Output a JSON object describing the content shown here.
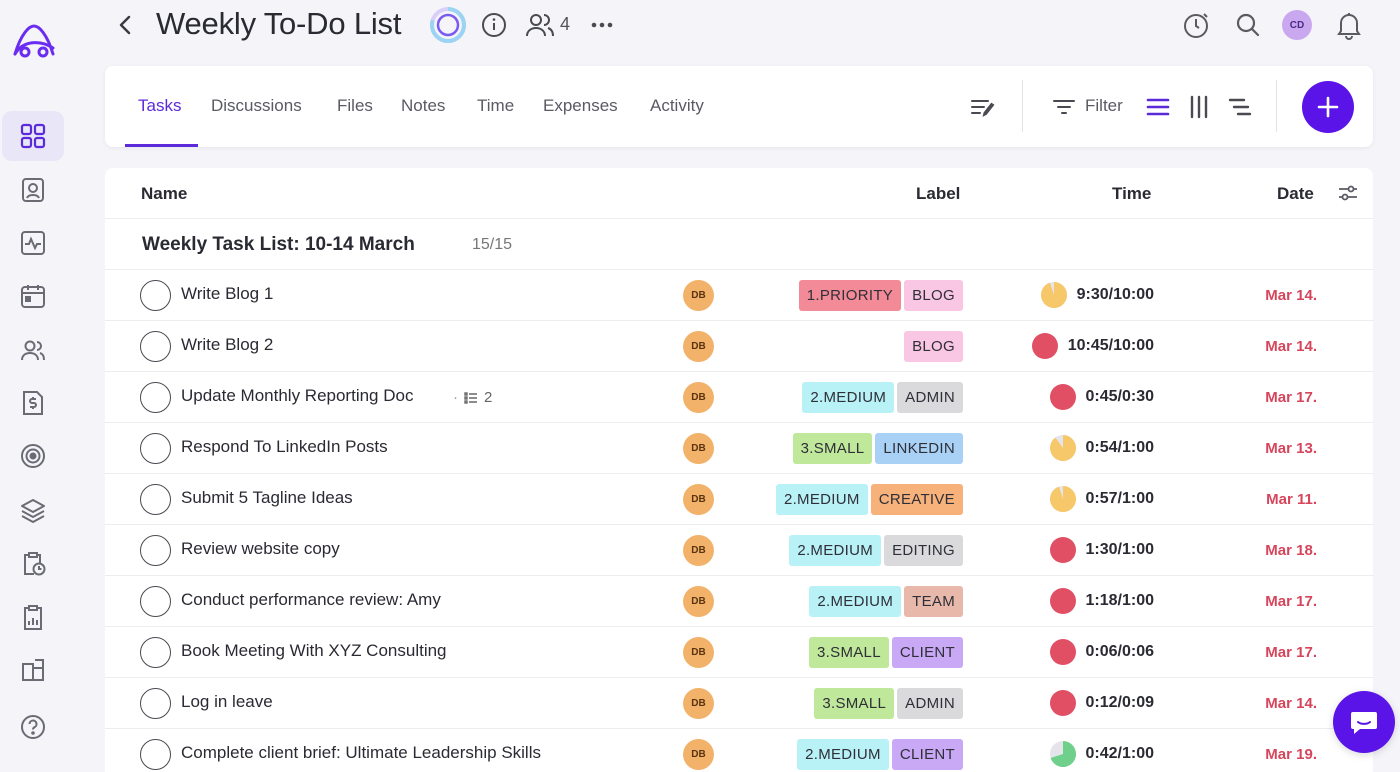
{
  "header": {
    "title": "Weekly To-Do List",
    "member_count": "4",
    "avatar_initials": "CD"
  },
  "tabs": [
    {
      "label": "Tasks",
      "active": true
    },
    {
      "label": "Discussions",
      "active": false
    },
    {
      "label": "Files",
      "active": false
    },
    {
      "label": "Notes",
      "active": false
    },
    {
      "label": "Time",
      "active": false
    },
    {
      "label": "Expenses",
      "active": false
    },
    {
      "label": "Activity",
      "active": false
    }
  ],
  "toolbar": {
    "filter_label": "Filter",
    "active_view": "list"
  },
  "table": {
    "columns": {
      "name": "Name",
      "label": "Label",
      "time": "Time",
      "date": "Date"
    },
    "group": {
      "title": "Weekly Task List:  10-14 March",
      "count": "15/15"
    },
    "rows": [
      {
        "name": "Write Blog 1",
        "assignee": "DB",
        "labels": [
          {
            "text": "1.PRIORITY",
            "color": "#f28b97"
          },
          {
            "text": "BLOG",
            "color": "#f9c6e3"
          }
        ],
        "time": "9:30/10:00",
        "progress": 0.95,
        "status_color": "#f7c86a",
        "date": "Mar 14."
      },
      {
        "name": "Write Blog 2",
        "assignee": "DB",
        "labels": [
          {
            "text": "BLOG",
            "color": "#f9c6e3"
          }
        ],
        "time": "10:45/10:00",
        "progress": 1.0,
        "status_color": "#e04f64",
        "date": "Mar 14."
      },
      {
        "name": "Update Monthly Reporting Doc",
        "assignee": "DB",
        "subtasks": "2",
        "labels": [
          {
            "text": "2.MEDIUM",
            "color": "#b8f1f6"
          },
          {
            "text": "ADMIN",
            "color": "#dadadd"
          }
        ],
        "time": "0:45/0:30",
        "progress": 1.0,
        "status_color": "#e04f64",
        "date": "Mar 17."
      },
      {
        "name": "Respond To LinkedIn Posts",
        "assignee": "DB",
        "labels": [
          {
            "text": "3.SMALL",
            "color": "#bfe89a"
          },
          {
            "text": "LINKEDIN",
            "color": "#a9d1f6"
          }
        ],
        "time": "0:54/1:00",
        "progress": 0.9,
        "status_color": "#f7c86a",
        "date": "Mar 13."
      },
      {
        "name": "Submit 5 Tagline Ideas",
        "assignee": "DB",
        "labels": [
          {
            "text": "2.MEDIUM",
            "color": "#b8f1f6"
          },
          {
            "text": "CREATIVE",
            "color": "#f6b27a"
          }
        ],
        "time": "0:57/1:00",
        "progress": 0.95,
        "status_color": "#f7c86a",
        "date": "Mar 11."
      },
      {
        "name": "Review website copy",
        "assignee": "DB",
        "labels": [
          {
            "text": "2.MEDIUM",
            "color": "#b8f1f6"
          },
          {
            "text": "EDITING",
            "color": "#dadadd"
          }
        ],
        "time": "1:30/1:00",
        "progress": 1.0,
        "status_color": "#e04f64",
        "date": "Mar 18."
      },
      {
        "name": "Conduct performance review: Amy",
        "assignee": "DB",
        "labels": [
          {
            "text": "2.MEDIUM",
            "color": "#b8f1f6"
          },
          {
            "text": "TEAM",
            "color": "#e8b9ab"
          }
        ],
        "time": "1:18/1:00",
        "progress": 1.0,
        "status_color": "#e04f64",
        "date": "Mar 17."
      },
      {
        "name": "Book Meeting With XYZ Consulting",
        "assignee": "DB",
        "labels": [
          {
            "text": "3.SMALL",
            "color": "#bfe89a"
          },
          {
            "text": "CLIENT",
            "color": "#c9a8f5"
          }
        ],
        "time": "0:06/0:06",
        "progress": 1.0,
        "status_color": "#e04f64",
        "date": "Mar 17."
      },
      {
        "name": "Log in leave",
        "assignee": "DB",
        "labels": [
          {
            "text": "3.SMALL",
            "color": "#bfe89a"
          },
          {
            "text": "ADMIN",
            "color": "#dadadd"
          }
        ],
        "time": "0:12/0:09",
        "progress": 1.0,
        "status_color": "#e04f64",
        "date": "Mar 14."
      },
      {
        "name": "Complete client brief: Ultimate Leadership Skills",
        "assignee": "DB",
        "labels": [
          {
            "text": "2.MEDIUM",
            "color": "#b8f1f6"
          },
          {
            "text": "CLIENT",
            "color": "#c9a8f5"
          }
        ],
        "time": "0:42/1:00",
        "progress": 0.7,
        "status_color": "#6fd08c",
        "date": "Mar 19."
      }
    ]
  },
  "sidebar": {
    "items": [
      {
        "icon": "dashboard-icon",
        "active": true
      },
      {
        "icon": "contacts-icon",
        "active": false
      },
      {
        "icon": "activity-icon",
        "active": false
      },
      {
        "icon": "calendar-icon",
        "active": false
      },
      {
        "icon": "people-icon",
        "active": false
      },
      {
        "icon": "invoice-icon",
        "active": false
      },
      {
        "icon": "goals-icon",
        "active": false
      },
      {
        "icon": "layers-icon",
        "active": false
      },
      {
        "icon": "timesheet-icon",
        "active": false
      },
      {
        "icon": "reports-icon",
        "active": false
      },
      {
        "icon": "apps-icon",
        "active": false
      },
      {
        "icon": "help-icon",
        "active": false
      }
    ]
  }
}
